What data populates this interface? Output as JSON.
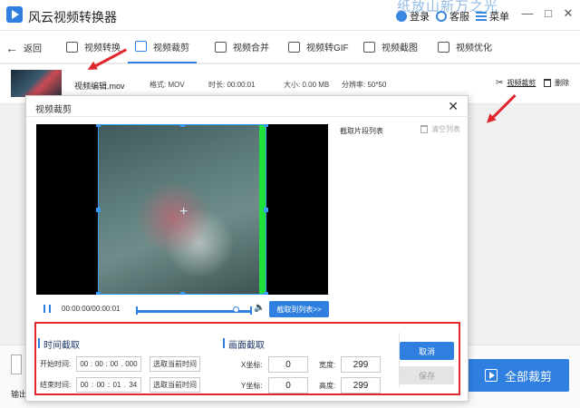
{
  "app": {
    "title": "风云视频转换器",
    "watermark": "纸放山新万之光",
    "login": "登录",
    "service": "客服",
    "menu": "菜单",
    "minimize": "—",
    "maximize": "□",
    "close": "✕"
  },
  "toolbar": {
    "back": "返回",
    "tabs": [
      {
        "label": "视频转换",
        "icon": "video-convert-icon"
      },
      {
        "label": "视频裁剪",
        "icon": "video-crop-icon",
        "active": true
      },
      {
        "label": "视频合并",
        "icon": "video-merge-icon"
      },
      {
        "label": "视频转GIF",
        "icon": "gif-icon"
      },
      {
        "label": "视频截图",
        "icon": "screenshot-icon"
      },
      {
        "label": "视频优化",
        "icon": "optimize-icon"
      }
    ]
  },
  "file": {
    "name": "视频编辑.mov",
    "format": "格式: MOV",
    "duration": "时长: 00:00:01",
    "size": "大小: 0.00 MB",
    "resolution": "分辨率: 50*50",
    "crop_action": "视频裁剪",
    "delete_action": "删除"
  },
  "bottom": {
    "output_label": "输出",
    "crop_all": "全部裁剪"
  },
  "dialog": {
    "title": "视频裁剪",
    "close": "✕",
    "segment_list_title": "截取片段列表",
    "clear_list": "清空列表",
    "timecode": "00:00:00/00:00:01",
    "add_to_list": "截取到列表>>",
    "time_section": {
      "title": "时间截取",
      "start_label": "开始时间:",
      "start": [
        "00",
        "00",
        "00",
        "000"
      ],
      "end_label": "结束时间:",
      "end": [
        "00",
        "00",
        "01",
        "34"
      ],
      "select_current": "选取当前时间"
    },
    "frame_section": {
      "title": "画面截取",
      "x_label": "X坐标:",
      "x_value": "0",
      "y_label": "Y坐标:",
      "y_value": "0",
      "width_label": "宽度:",
      "width_value": "299",
      "height_label": "高度:",
      "height_value": "299"
    },
    "cancel": "取消",
    "save": "保存",
    "playback_progress": 0.88
  },
  "colors": {
    "accent": "#2e7fe0",
    "highlight": "#e0262c",
    "green_bar": "#22e03a"
  }
}
